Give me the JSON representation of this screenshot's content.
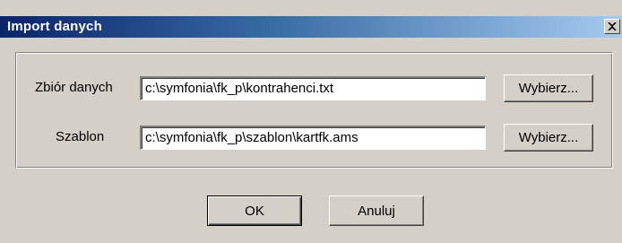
{
  "window": {
    "title": "Import danych",
    "close_symbol": "×"
  },
  "form": {
    "dataset": {
      "label": "Zbiór danych",
      "value": "c:\\symfonia\\fk_p\\kontrahenci.txt",
      "button_label": "Wybierz..."
    },
    "template": {
      "label": "Szablon",
      "value": "c:\\symfonia\\fk_p\\szablon\\kartfk.ams",
      "button_label": "Wybierz..."
    }
  },
  "actions": {
    "ok_label": "OK",
    "cancel_label": "Anuluj"
  },
  "colors": {
    "dialog_background": "#d4d0c8",
    "titlebar_start": "#0a246a",
    "titlebar_end": "#a6caf0",
    "titlebar_text": "#ffffff",
    "field_background": "#ffffff"
  },
  "icons": {
    "close": "close-icon"
  }
}
